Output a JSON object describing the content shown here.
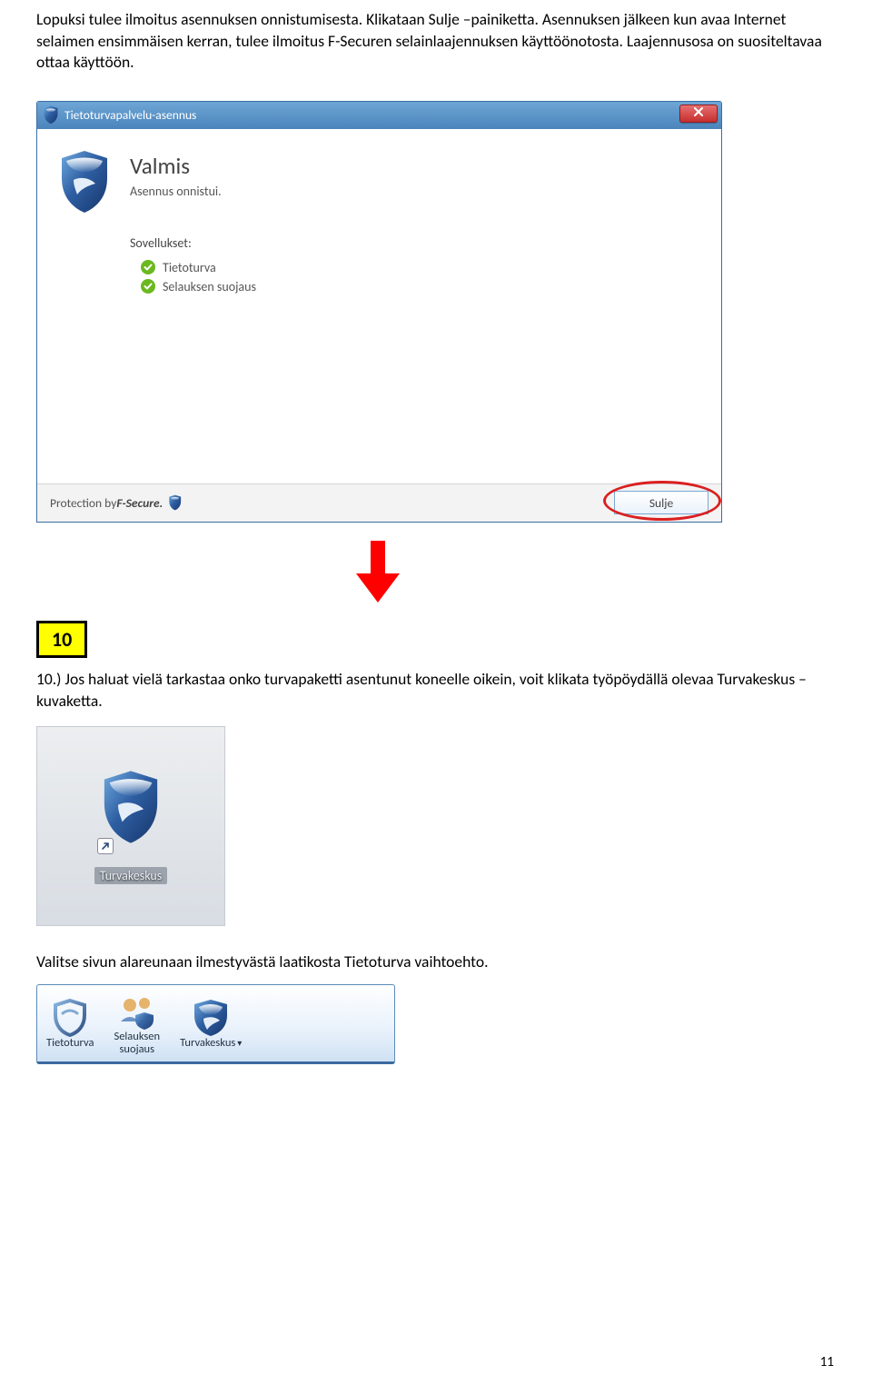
{
  "intro": "Lopuksi tulee ilmoitus asennuksen onnistumisesta. Klikataan Sulje –painiketta. Asennuksen jälkeen kun avaa Internet selaimen ensimmäisen kerran, tulee ilmoitus F-Securen selainlaajennuksen käyttöönotosta. Laajennusosa on suositeltavaa ottaa käyttöön.",
  "dialog": {
    "title": "Tietoturvapalvelu-asennus",
    "status_title": "Valmis",
    "status_sub": "Asennus onnistui.",
    "apps_label": "Sovellukset:",
    "apps": [
      "Tietoturva",
      "Selauksen suojaus"
    ],
    "protection_prefix": "Protection by ",
    "brand": "F-Secure.",
    "close_label": "Sulje"
  },
  "step": {
    "number": "10",
    "text": "10.) Jos haluat vielä tarkastaa onko turvapaketti asentunut koneelle oikein, voit klikata työpöydällä olevaa Turvakeskus –kuvaketta."
  },
  "desktop_icon": {
    "label": "Turvakeskus"
  },
  "footer_text": "Valitse sivun alareunaan ilmestyvästä laatikosta Tietoturva vaihtoehto.",
  "toolbar": {
    "items": [
      {
        "icon": "shield-outline",
        "line1": "Tietoturva",
        "line2": ""
      },
      {
        "icon": "users-shield",
        "line1": "Selauksen",
        "line2": "suojaus"
      },
      {
        "icon": "shield-swirl",
        "line1": "Turvakeskus",
        "line2": "",
        "menu": "▾"
      }
    ]
  },
  "page_number": "11"
}
